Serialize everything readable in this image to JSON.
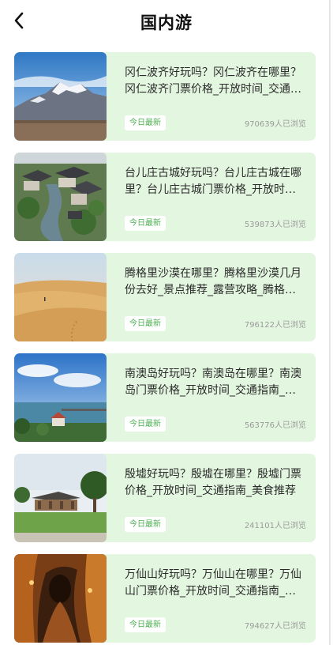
{
  "header": {
    "title": "国内游"
  },
  "icons": {
    "back": "chevron-left-icon"
  },
  "colors": {
    "card_background": "#e3f7e0",
    "badge_text": "#4caf50"
  },
  "articles": [
    {
      "title": "冈仁波齐好玩吗？冈仁波齐在哪里？冈仁波齐门票价格_开放时间_交通指南_美食推荐",
      "badge": "今日最新",
      "views": "970639人已浏览"
    },
    {
      "title": "台儿庄古城好玩吗？台儿庄古城在哪里？台儿庄古城门票价格_开放时间_交通指南",
      "badge": "今日最新",
      "views": "539873人已浏览"
    },
    {
      "title": "腾格里沙漠在哪里？腾格里沙漠几月份去好_景点推荐_露营攻略_腾格里沙漠旅游攻略",
      "badge": "今日最新",
      "views": "796122人已浏览"
    },
    {
      "title": "南澳岛好玩吗？南澳岛在哪里？南澳岛门票价格_开放时间_交通指南_美食推荐",
      "badge": "今日最新",
      "views": "563776人已浏览"
    },
    {
      "title": "殷墟好玩吗？殷墟在哪里？殷墟门票价格_开放时间_交通指南_美食推荐",
      "badge": "今日最新",
      "views": "241101人已浏览"
    },
    {
      "title": "万仙山好玩吗？万仙山在哪里？万仙山门票价格_开放时间_交通指南_美食推荐",
      "badge": "今日最新",
      "views": "794627人已浏览"
    }
  ]
}
